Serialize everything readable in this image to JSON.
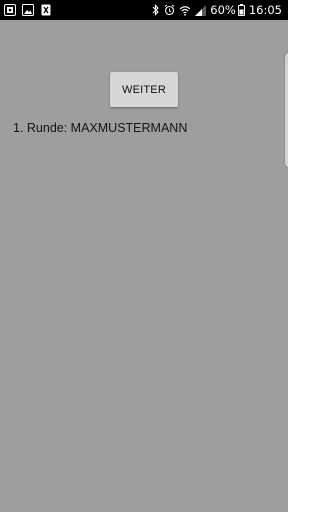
{
  "status_bar": {
    "notifications": [
      "image-notification-icon",
      "gallery-notification-icon",
      "file-notification-icon"
    ],
    "battery_percent": "60%",
    "time": "16:05",
    "icons": [
      "bluetooth-icon",
      "alarm-icon",
      "wifi-icon",
      "signal-icon",
      "battery-icon"
    ]
  },
  "main": {
    "button_label": "WEITER",
    "round_text": "1. Runde: MAXMUSTERMANN"
  },
  "colors": {
    "background": "#9e9e9e",
    "status_bar": "#000000",
    "button": "#d6d6d6"
  }
}
